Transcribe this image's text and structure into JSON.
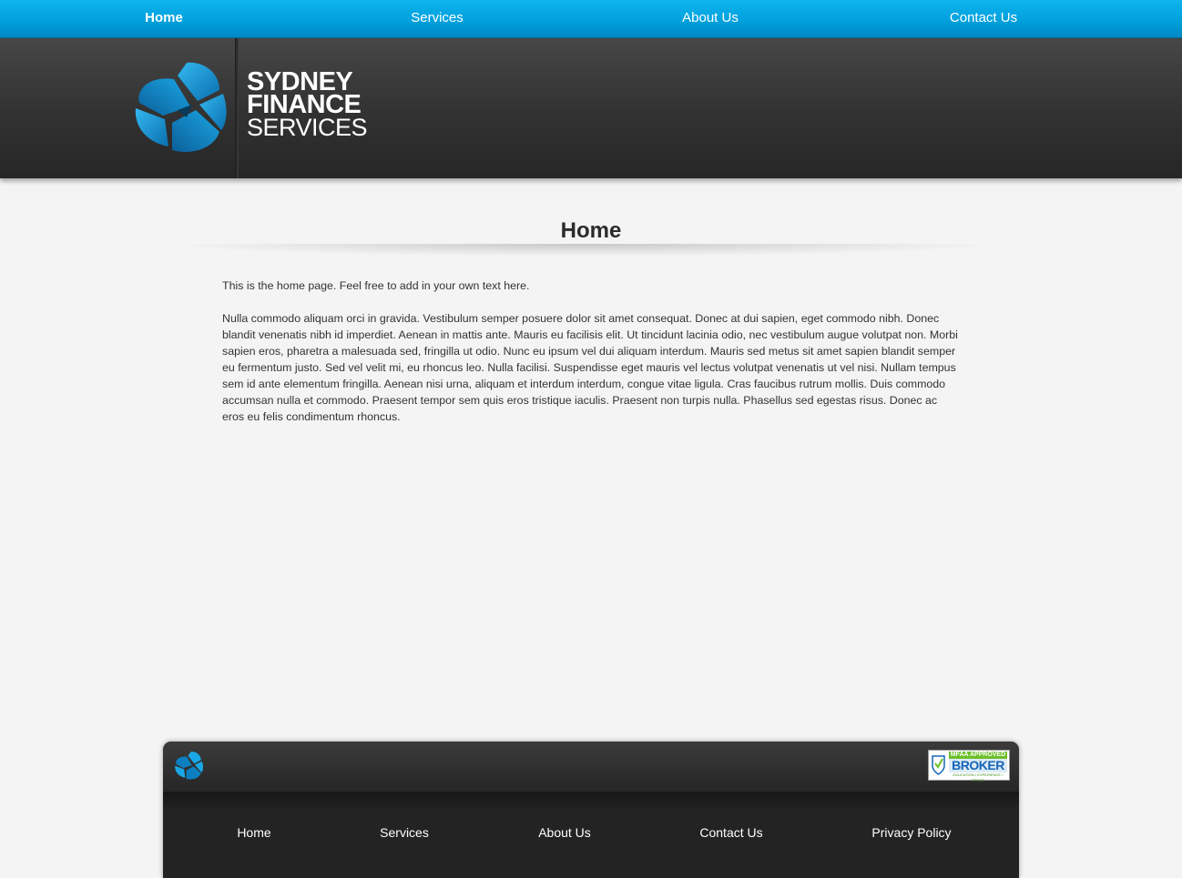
{
  "topnav": {
    "items": [
      "Home",
      "Services",
      "About Us",
      "Contact Us"
    ],
    "active": "Home"
  },
  "logo": {
    "line1": "SYDNEY",
    "line2": "FINANCE",
    "line3": "SERVICES",
    "icon": "triangular-swirl-logo-icon"
  },
  "main": {
    "title": "Home",
    "paragraphs": [
      "This is the home page. Feel free to add in your own text here.",
      "Nulla commodo aliquam orci in gravida. Vestibulum semper posuere dolor sit amet consequat. Donec at dui sapien, eget commodo nibh. Donec blandit venenatis nibh id imperdiet. Aenean in mattis ante. Mauris eu facilisis elit. Ut tincidunt lacinia odio, nec vestibulum augue volutpat non. Morbi sapien eros, pharetra a malesuada sed, fringilla ut odio. Nunc eu ipsum vel dui aliquam interdum. Mauris sed metus sit amet sapien blandit semper eu fermentum justo. Sed vel velit mi, eu rhoncus leo. Nulla facilisi. Suspendisse eget mauris vel lectus volutpat venenatis ut vel nisi. Nullam tempus sem id ante elementum fringilla. Aenean nisi urna, aliquam et interdum interdum, congue vitae ligula. Cras faucibus rutrum mollis. Duis commodo accumsan nulla et commodo. Praesent tempor sem quis eros tristique iaculis. Praesent non turpis nulla. Phasellus sed egestas risus. Donec ac eros eu felis condimentum rhoncus."
    ]
  },
  "footer": {
    "links": [
      "Home",
      "Services",
      "About Us",
      "Contact Us",
      "Privacy Policy"
    ],
    "badge": {
      "top": "MFAA APPROVED",
      "main": "BROKER",
      "sub": "EDUCATION • EXPERIENCE • ETHICS"
    }
  },
  "colors": {
    "nav_blue": "#01a1dd",
    "header_dark": "#333333",
    "logo_blue": "#0b95d3",
    "page_bg": "#f4f4f4"
  }
}
